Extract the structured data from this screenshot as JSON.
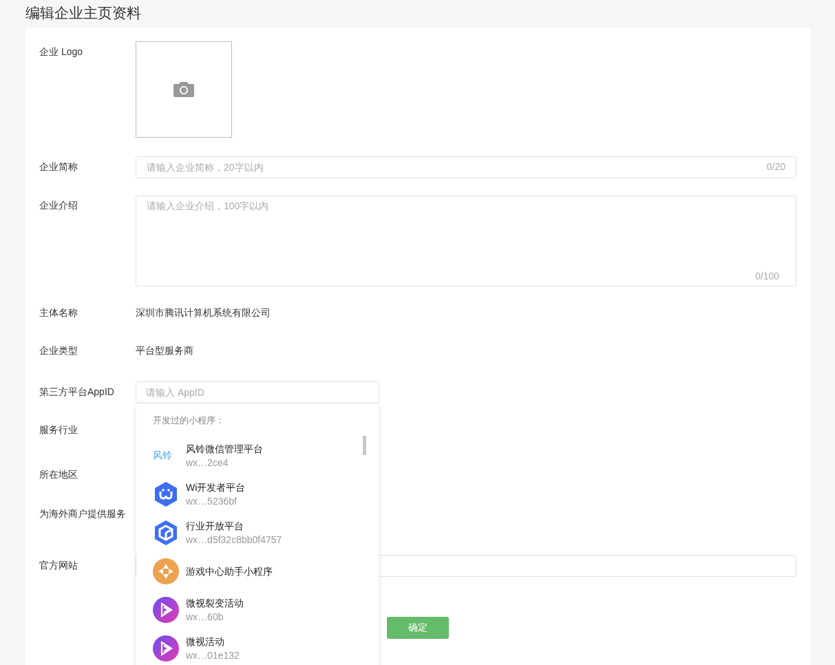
{
  "page_title": "编辑企业主页资料",
  "form": {
    "logo": {
      "label": "企业 Logo"
    },
    "short_name": {
      "label": "企业简称",
      "placeholder": "请输入企业简称，20字以内",
      "counter": "0/20"
    },
    "intro": {
      "label": "企业介绍",
      "placeholder": "请输入企业介绍，100字以内",
      "counter": "0/100"
    },
    "entity": {
      "label": "主体名称",
      "value": "深圳市腾讯计算机系统有限公司"
    },
    "type": {
      "label": "企业类型",
      "value": "平台型服务商"
    },
    "appid": {
      "label": "第三方平台AppID",
      "placeholder": "请输入 AppID"
    },
    "industry": {
      "label": "服务行业"
    },
    "region": {
      "label": "所在地区"
    },
    "overseas": {
      "label": "为海外商户提供服务"
    },
    "website": {
      "label": "官方网站"
    },
    "submit": "确定"
  },
  "dropdown": {
    "heading": "开发过的小程序：",
    "items": [
      {
        "kind": "text-logo",
        "logo_text": "风铃",
        "name": "风铃微信管理平台",
        "appid": "wx…2ce4"
      },
      {
        "kind": "hex-w",
        "name": "Wi开发者平台",
        "appid": "wx…5236bf"
      },
      {
        "kind": "hex-cube",
        "name": "行业开放平台",
        "appid": "wx…d5f32c8bb0f4757"
      },
      {
        "kind": "orange-target",
        "name": "游戏中心助手小程序"
      },
      {
        "kind": "purple-play",
        "name": "微视裂变活动",
        "appid": "wx…60b"
      },
      {
        "kind": "purple-play",
        "name": "微视活动",
        "appid": "wx…01e132"
      }
    ]
  }
}
